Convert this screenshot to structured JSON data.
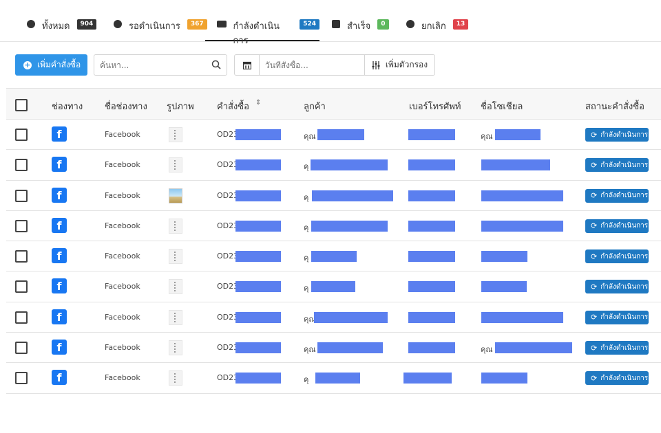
{
  "tabs": [
    {
      "label": "ทั้งหมด",
      "count": "904",
      "color": "#333333",
      "icon": "globe-icon"
    },
    {
      "label": "รอดำเนินการ",
      "count": "367",
      "color": "#f0a22e",
      "icon": "clock-icon"
    },
    {
      "label": "กำลังดำเนินการ",
      "count": "524",
      "color": "#1f79c2",
      "icon": "truck-icon",
      "active": true
    },
    {
      "label": "สำเร็จ",
      "count": "0",
      "color": "#5cb85c",
      "icon": "calendar-check-icon"
    },
    {
      "label": "ยกเลิก",
      "count": "13",
      "color": "#e0434b",
      "icon": "cancel-circle-icon"
    }
  ],
  "toolbar": {
    "add_label": "เพิ่มคำสั่งซื้อ",
    "search_placeholder": "ค้นหา...",
    "date_placeholder": "วันที่สั่งซื้อ...",
    "filter_label": "เพิ่มตัวกรอง"
  },
  "columns": [
    "ช่องทาง",
    "ชื่อช่องทาง",
    "รูปภาพ",
    "คำสั่งซื้อ",
    "ลูกค้า",
    "เบอร์โทรศัพท์",
    "ชื่อโซเชียล",
    "สถานะคำสั่งซื้อ"
  ],
  "rows": [
    {
      "channel_icon": "facebook-icon",
      "channel_name": "Facebook",
      "order_prefix": "OD23",
      "customer_prefix": "คุณ",
      "social_prefix": "คุณ",
      "status": "กำลังดำเนินการ",
      "photo": false
    },
    {
      "channel_icon": "facebook-icon",
      "channel_name": "Facebook",
      "order_prefix": "OD23",
      "customer_prefix": "คุ",
      "social_prefix": "",
      "status": "กำลังดำเนินการ",
      "photo": false
    },
    {
      "channel_icon": "facebook-icon",
      "channel_name": "Facebook",
      "order_prefix": "OD23",
      "customer_prefix": "คุ",
      "social_prefix": "",
      "status": "กำลังดำเนินการ",
      "photo": true
    },
    {
      "channel_icon": "facebook-icon",
      "channel_name": "Facebook",
      "order_prefix": "OD23",
      "customer_prefix": "คุ",
      "social_prefix": "",
      "status": "กำลังดำเนินการ",
      "photo": false
    },
    {
      "channel_icon": "facebook-icon",
      "channel_name": "Facebook",
      "order_prefix": "OD23",
      "customer_prefix": "คุ",
      "social_prefix": "",
      "status": "กำลังดำเนินการ",
      "photo": false
    },
    {
      "channel_icon": "facebook-icon",
      "channel_name": "Facebook",
      "order_prefix": "OD23",
      "customer_prefix": "คุ",
      "social_prefix": "",
      "status": "กำลังดำเนินการ",
      "photo": false
    },
    {
      "channel_icon": "facebook-icon",
      "channel_name": "Facebook",
      "order_prefix": "OD23",
      "customer_prefix": "คุณ",
      "social_prefix": "",
      "status": "กำลังดำเนินการ",
      "photo": false
    },
    {
      "channel_icon": "facebook-icon",
      "channel_name": "Facebook",
      "order_prefix": "OD23",
      "customer_prefix": "คุณ",
      "social_prefix": "คุณ",
      "status": "กำลังดำเนินการ",
      "photo": false
    },
    {
      "channel_icon": "facebook-icon",
      "channel_name": "Facebook",
      "order_prefix": "OD23",
      "customer_prefix": "คุ",
      "social_prefix": "",
      "status": "กำลังดำเนินการ",
      "photo": false
    }
  ],
  "colors": {
    "accent": "#2f95e8",
    "status_bg": "#1f79c2",
    "redaction": "#5b7fef",
    "facebook": "#1877f2"
  }
}
